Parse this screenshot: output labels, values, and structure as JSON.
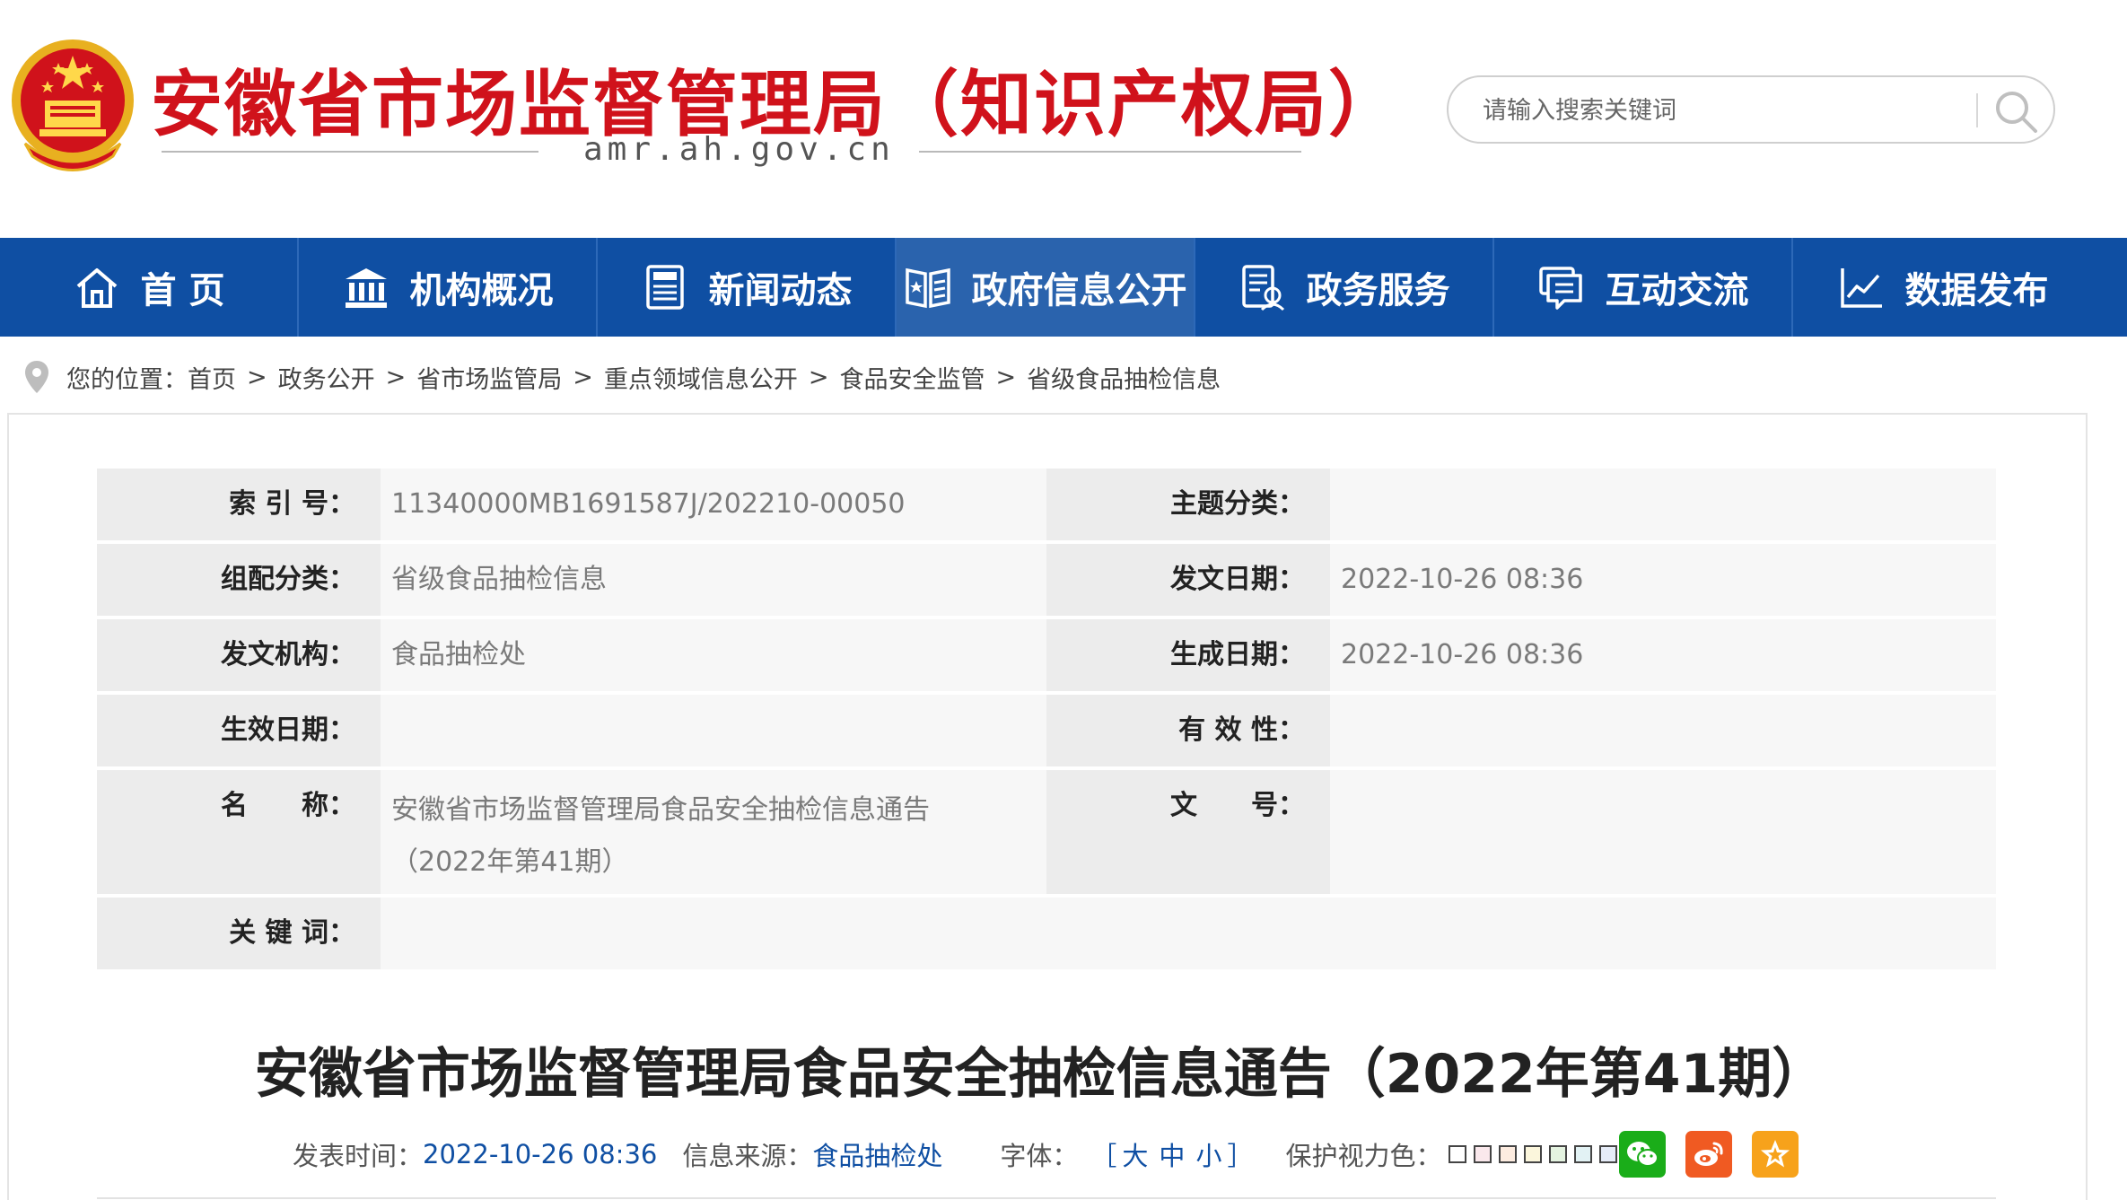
{
  "header": {
    "site_title": "安徽省市场监督管理局（知识产权局）",
    "domain": "amr.ah.gov.cn",
    "search": {
      "placeholder": "请输入搜索关键词"
    }
  },
  "nav": {
    "items": [
      {
        "label": "首 页",
        "icon": "home-icon"
      },
      {
        "label": "机构概况",
        "icon": "building-icon"
      },
      {
        "label": "新闻动态",
        "icon": "news-icon"
      },
      {
        "label": "政府信息公开",
        "icon": "info-open-icon",
        "active": true
      },
      {
        "label": "政务服务",
        "icon": "service-icon"
      },
      {
        "label": "互动交流",
        "icon": "chat-icon"
      },
      {
        "label": "数据发布",
        "icon": "chart-icon"
      }
    ]
  },
  "breadcrumb": {
    "prefix": "您的位置：",
    "items": [
      "首页",
      "政务公开",
      "省市场监管局",
      "重点领域信息公开",
      "食品安全监管",
      "省级食品抽检信息"
    ],
    "separator": ">"
  },
  "meta": {
    "index_label": "索 引 号：",
    "index_value": "11340000MB1691587J/202210-00050",
    "topic_label": "主题分类：",
    "topic_value": "",
    "category_label": "组配分类：",
    "category_value": "省级食品抽检信息",
    "issue_date_label": "发文日期：",
    "issue_date_value": "2022-10-26 08:36",
    "issuer_label": "发文机构：",
    "issuer_value": "食品抽检处",
    "created_label": "生成日期：",
    "created_value": "2022-10-26 08:36",
    "effective_label": "生效日期：",
    "effective_value": "",
    "validity_label": "有 效 性：",
    "validity_value": "",
    "name_label": "名　　称：",
    "name_value": "安徽省市场监督管理局食品安全抽检信息通告（2022年第41期）",
    "docnum_label": "文　　号：",
    "docnum_value": "",
    "keywords_label": "关 键 词：",
    "keywords_value": ""
  },
  "article": {
    "title": "安徽省市场监督管理局食品安全抽检信息通告（2022年第41期）",
    "publish_label": "发表时间：",
    "publish_time": "2022-10-26 08:36",
    "source_label": "信息来源：",
    "source_value": "食品抽检处",
    "font_label": "字体：",
    "font_open": "［",
    "font_large": "大",
    "font_medium": "中",
    "font_small": "小",
    "font_close": "］",
    "eye_label": "保护视力色："
  },
  "colors": {
    "brand_blue": "#0f4fa3",
    "title_red": "#d0121b",
    "wechat_green": "#1aad19",
    "weibo_orange": "#f05a22",
    "favorite_orange": "#f7a21b"
  }
}
